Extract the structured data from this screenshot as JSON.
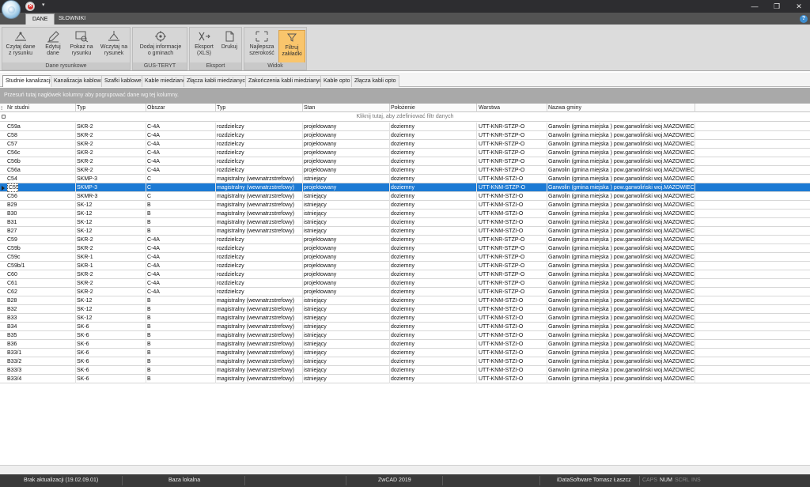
{
  "titlebar": {
    "window_buttons": [
      "—",
      "❐",
      "✕"
    ]
  },
  "ribbon_tabs": [
    {
      "label": "DANE",
      "active": true
    },
    {
      "label": "SŁOWNIKI",
      "active": false
    }
  ],
  "ribbon": {
    "groups": [
      {
        "label": "Dane rysunkowe",
        "buttons": [
          {
            "line1": "Czytaj dane",
            "line2": "z rysunku",
            "icon": "read-drawing-icon"
          },
          {
            "line1": "Edytuj",
            "line2": "dane",
            "icon": "edit-pencil-icon"
          },
          {
            "line1": "Pokaż na",
            "line2": "rysunku",
            "icon": "show-on-drawing-icon"
          },
          {
            "line1": "Wczytaj na",
            "line2": "rysunek",
            "icon": "load-drawing-icon"
          }
        ]
      },
      {
        "label": "GUS-TERYT",
        "buttons": [
          {
            "line1": "Dodaj informacje",
            "line2": "o gminach",
            "icon": "target-add-icon"
          }
        ]
      },
      {
        "label": "Eksport",
        "buttons": [
          {
            "line1": "Eksport",
            "line2": "(XLS)",
            "icon": "export-xls-icon"
          },
          {
            "line1": "Drukuj",
            "line2": "",
            "icon": "print-icon"
          }
        ]
      },
      {
        "label": "Widok",
        "buttons": [
          {
            "line1": "Najlepsza",
            "line2": "szerokość",
            "icon": "best-fit-icon"
          },
          {
            "line1": "Filtruj",
            "line2": "zakładki",
            "icon": "filter-funnel-icon",
            "active": true
          }
        ]
      }
    ]
  },
  "sub_tabs": [
    {
      "label": "Studnie kanalizacji",
      "active": true
    },
    {
      "label": "Kanalizacja kablowa"
    },
    {
      "label": "Szafki kablowe"
    },
    {
      "label": "Kable miedziane"
    },
    {
      "label": "Złącza kabli miedzianych"
    },
    {
      "label": "Zakończenia kabli miedzianych"
    },
    {
      "label": "Kable opto"
    },
    {
      "label": "Złącza kabli opto"
    }
  ],
  "group_panel_text": "Przesuń tutaj nagłówek kolumny aby pogrupować dane wg tej kolumny.",
  "filter_row_text": "Kliknij tutaj, aby zdefiniować filtr danych",
  "columns": [
    "Nr studni",
    "Typ",
    "Obszar",
    "Typ",
    "Stan",
    "Położenie",
    "Warstwa",
    "Nazwa gminy"
  ],
  "rows": [
    [
      "C59a",
      "SKR-2",
      "C-4A",
      "rozdzielczy",
      "projektowany",
      "doziemny",
      "UTT-KNR-STZP-O",
      "Garwolin (gmina miejska ) pow.garwoliński woj.MAZOWIECKIE"
    ],
    [
      "C58",
      "SKR-2",
      "C-4A",
      "rozdzielczy",
      "projektowany",
      "doziemny",
      "UTT-KNR-STZP-O",
      "Garwolin (gmina miejska ) pow.garwoliński woj.MAZOWIECKIE"
    ],
    [
      "C57",
      "SKR-2",
      "C-4A",
      "rozdzielczy",
      "projektowany",
      "doziemny",
      "UTT-KNR-STZP-O",
      "Garwolin (gmina miejska ) pow.garwoliński woj.MAZOWIECKIE"
    ],
    [
      "C56c",
      "SKR-2",
      "C-4A",
      "rozdzielczy",
      "projektowany",
      "doziemny",
      "UTT-KNR-STZP-O",
      "Garwolin (gmina miejska ) pow.garwoliński woj.MAZOWIECKIE"
    ],
    [
      "C56b",
      "SKR-2",
      "C-4A",
      "rozdzielczy",
      "projektowany",
      "doziemny",
      "UTT-KNR-STZP-O",
      "Garwolin (gmina miejska ) pow.garwoliński woj.MAZOWIECKIE"
    ],
    [
      "C56a",
      "SKR-2",
      "C-4A",
      "rozdzielczy",
      "projektowany",
      "doziemny",
      "UTT-KNR-STZP-O",
      "Garwolin (gmina miejska ) pow.garwoliński woj.MAZOWIECKIE"
    ],
    [
      "C54",
      "SKMP-3",
      "C",
      "magistralny (wewnatrzstrefowy)",
      "istniejący",
      "doziemny",
      "UTT-KNM-STZI-O",
      "Garwolin (gmina miejska ) pow.garwoliński woj.MAZOWIECKIE"
    ],
    [
      "C55",
      "SKMP-3",
      "C",
      "magistralny (wewnatrzstrefowy)",
      "projektowany",
      "doziemny",
      "UTT-KNM-STZP-O",
      "Garwolin (gmina miejska ) pow.garwoliński woj.MAZOWIECKIE"
    ],
    [
      "C56",
      "SKMR-3",
      "C",
      "magistralny (wewnatrzstrefowy)",
      "istniejący",
      "doziemny",
      "UTT-KNM-STZI-O",
      "Garwolin (gmina miejska ) pow.garwoliński woj.MAZOWIECKIE"
    ],
    [
      "B29",
      "SK-12",
      "B",
      "magistralny (wewnatrzstrefowy)",
      "istniejący",
      "doziemny",
      "UTT-KNM-STZI-O",
      "Garwolin (gmina miejska ) pow.garwoliński woj.MAZOWIECKIE"
    ],
    [
      "B30",
      "SK-12",
      "B",
      "magistralny (wewnatrzstrefowy)",
      "istniejący",
      "doziemny",
      "UTT-KNM-STZI-O",
      "Garwolin (gmina miejska ) pow.garwoliński woj.MAZOWIECKIE"
    ],
    [
      "B31",
      "SK-12",
      "B",
      "magistralny (wewnatrzstrefowy)",
      "istniejący",
      "doziemny",
      "UTT-KNM-STZI-O",
      "Garwolin (gmina miejska ) pow.garwoliński woj.MAZOWIECKIE"
    ],
    [
      "B27",
      "SK-12",
      "B",
      "magistralny (wewnatrzstrefowy)",
      "istniejący",
      "doziemny",
      "UTT-KNM-STZI-O",
      "Garwolin (gmina miejska ) pow.garwoliński woj.MAZOWIECKIE"
    ],
    [
      "C59",
      "SKR-2",
      "C-4A",
      "rozdzielczy",
      "projektowany",
      "doziemny",
      "UTT-KNR-STZP-O",
      "Garwolin (gmina miejska ) pow.garwoliński woj.MAZOWIECKIE"
    ],
    [
      "C59b",
      "SKR-2",
      "C-4A",
      "rozdzielczy",
      "projektowany",
      "doziemny",
      "UTT-KNR-STZP-O",
      "Garwolin (gmina miejska ) pow.garwoliński woj.MAZOWIECKIE"
    ],
    [
      "C59c",
      "SKR-1",
      "C-4A",
      "rozdzielczy",
      "projektowany",
      "doziemny",
      "UTT-KNR-STZP-O",
      "Garwolin (gmina miejska ) pow.garwoliński woj.MAZOWIECKIE"
    ],
    [
      "C59b/1",
      "SKR-1",
      "C-4A",
      "rozdzielczy",
      "projektowany",
      "doziemny",
      "UTT-KNR-STZP-O",
      "Garwolin (gmina miejska ) pow.garwoliński woj.MAZOWIECKIE"
    ],
    [
      "C60",
      "SKR-2",
      "C-4A",
      "rozdzielczy",
      "projektowany",
      "doziemny",
      "UTT-KNR-STZP-O",
      "Garwolin (gmina miejska ) pow.garwoliński woj.MAZOWIECKIE"
    ],
    [
      "C61",
      "SKR-2",
      "C-4A",
      "rozdzielczy",
      "projektowany",
      "doziemny",
      "UTT-KNR-STZP-O",
      "Garwolin (gmina miejska ) pow.garwoliński woj.MAZOWIECKIE"
    ],
    [
      "C62",
      "SKR-2",
      "C-4A",
      "rozdzielczy",
      "projektowany",
      "doziemny",
      "UTT-KNR-STZP-O",
      "Garwolin (gmina miejska ) pow.garwoliński woj.MAZOWIECKIE"
    ],
    [
      "B28",
      "SK-12",
      "B",
      "magistralny (wewnatrzstrefowy)",
      "istniejący",
      "doziemny",
      "UTT-KNM-STZI-O",
      "Garwolin (gmina miejska ) pow.garwoliński woj.MAZOWIECKIE"
    ],
    [
      "B32",
      "SK-12",
      "B",
      "magistralny (wewnatrzstrefowy)",
      "istniejący",
      "doziemny",
      "UTT-KNM-STZI-O",
      "Garwolin (gmina miejska ) pow.garwoliński woj.MAZOWIECKIE"
    ],
    [
      "B33",
      "SK-12",
      "B",
      "magistralny (wewnatrzstrefowy)",
      "istniejący",
      "doziemny",
      "UTT-KNM-STZI-O",
      "Garwolin (gmina miejska ) pow.garwoliński woj.MAZOWIECKIE"
    ],
    [
      "B34",
      "SK-6",
      "B",
      "magistralny (wewnatrzstrefowy)",
      "istniejący",
      "doziemny",
      "UTT-KNM-STZI-O",
      "Garwolin (gmina miejska ) pow.garwoliński woj.MAZOWIECKIE"
    ],
    [
      "B35",
      "SK-6",
      "B",
      "magistralny (wewnatrzstrefowy)",
      "istniejący",
      "doziemny",
      "UTT-KNM-STZI-O",
      "Garwolin (gmina miejska ) pow.garwoliński woj.MAZOWIECKIE"
    ],
    [
      "B36",
      "SK-6",
      "B",
      "magistralny (wewnatrzstrefowy)",
      "istniejący",
      "doziemny",
      "UTT-KNM-STZI-O",
      "Garwolin (gmina miejska ) pow.garwoliński woj.MAZOWIECKIE"
    ],
    [
      "B33/1",
      "SK-6",
      "B",
      "magistralny (wewnatrzstrefowy)",
      "istniejący",
      "doziemny",
      "UTT-KNM-STZI-O",
      "Garwolin (gmina miejska ) pow.garwoliński woj.MAZOWIECKIE"
    ],
    [
      "B33/2",
      "SK-6",
      "B",
      "magistralny (wewnatrzstrefowy)",
      "istniejący",
      "doziemny",
      "UTT-KNM-STZI-O",
      "Garwolin (gmina miejska ) pow.garwoliński woj.MAZOWIECKIE"
    ],
    [
      "B33/3",
      "SK-6",
      "B",
      "magistralny (wewnatrzstrefowy)",
      "istniejący",
      "doziemny",
      "UTT-KNM-STZI-O",
      "Garwolin (gmina miejska ) pow.garwoliński woj.MAZOWIECKIE"
    ],
    [
      "B33/4",
      "SK-6",
      "B",
      "magistralny (wewnatrzstrefowy)",
      "istniejący",
      "doziemny",
      "UTT-KNM-STZI-O",
      "Garwolin (gmina miejska ) pow.garwoliński woj.MAZOWIECKIE"
    ]
  ],
  "selected_row": 7,
  "statusbar": {
    "last_update": "Brak aktualizacji (19.02.09.01)",
    "database": "Baza lokalna",
    "cad": "ZwCAD 2019",
    "vendor": "iDataSoftware Tomasz Łaszcz",
    "caps": "CAPS",
    "num": "NUM",
    "scrl": "SCRL",
    "ins": "INS"
  },
  "colors": {
    "selection": "#1c7ad4",
    "active_button": "#f9c56c",
    "statusbar": "#3a3a3a",
    "titlebar": "#2d2d30"
  }
}
